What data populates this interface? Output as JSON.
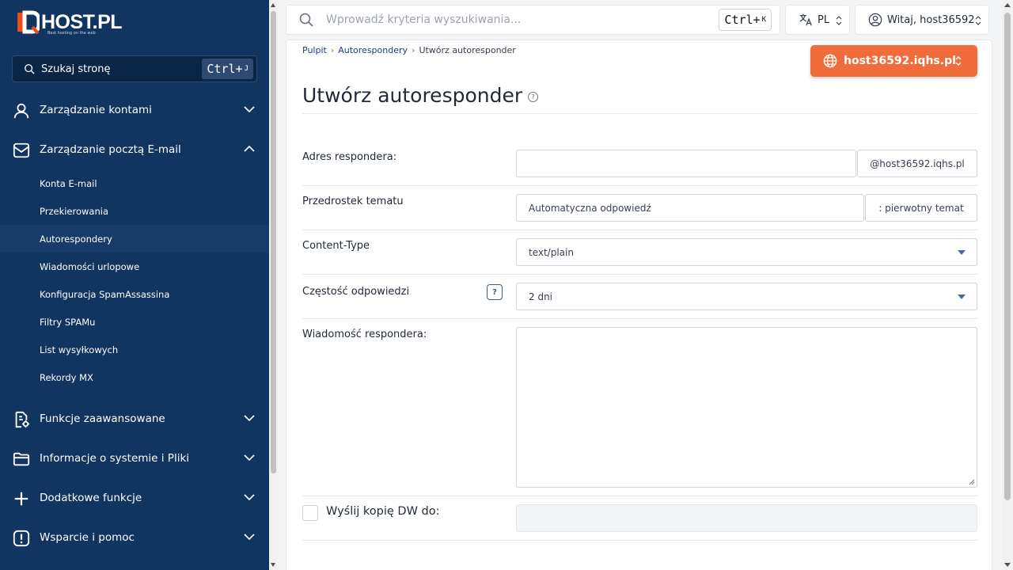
{
  "brand": {
    "name": "HOST.PL",
    "tagline": "Best hosting on the web"
  },
  "sidebar": {
    "search_label": "Szukaj stronę",
    "search_kbd": "Ctrl+",
    "search_kbd_key": "J",
    "groups": [
      {
        "label": "Zarządzanie kontami",
        "icon": "user-icon",
        "expanded": false
      },
      {
        "label": "Zarządzanie pocztą E-mail",
        "icon": "mail-icon",
        "expanded": true
      },
      {
        "label": "Funkcje zaawansowane",
        "icon": "document-gear-icon",
        "expanded": false
      },
      {
        "label": "Informacje o systemie i Pliki",
        "icon": "folder-icon",
        "expanded": false
      },
      {
        "label": "Dodatkowe funkcje",
        "icon": "plus-icon",
        "expanded": false
      },
      {
        "label": "Wsparcie i pomoc",
        "icon": "alert-icon",
        "expanded": false
      }
    ],
    "email_items": [
      {
        "label": "Konta E-mail"
      },
      {
        "label": "Przekierowania"
      },
      {
        "label": "Autorespondery",
        "active": true
      },
      {
        "label": "Wiadomości urlopowe"
      },
      {
        "label": "Konfiguracja SpamAssassina"
      },
      {
        "label": "Filtry SPAMu"
      },
      {
        "label": "List wysyłkowych"
      },
      {
        "label": "Rekordy MX"
      }
    ]
  },
  "topbar": {
    "search_placeholder": "Wprowadź kryteria wyszukiwania...",
    "search_kbd": "Ctrl+",
    "search_kbd_key": "K",
    "language": "PL",
    "user_greeting": "Witaj, host36592"
  },
  "breadcrumb": [
    "Pulpit",
    "Autorespondery",
    "Utwórz autoresponder"
  ],
  "domain_selector": "host36592.iqhs.pl",
  "page_title": "Utwórz autoresponder",
  "form": {
    "address_label": "Adres respondera:",
    "address_value": "",
    "address_suffix": "@host36592.iqhs.pl",
    "subject_label": "Przedrostek tematu",
    "subject_value": "Automatyczna odpowiedź",
    "subject_suffix": ": pierwotny temat",
    "content_type_label": "Content-Type",
    "content_type_value": "text/plain",
    "frequency_label": "Częstość odpowiedzi",
    "frequency_value": "2 dni",
    "message_label": "Wiadomość respondera:",
    "cc_label": "Wyślij kopię DW do:",
    "cc_checked": false
  },
  "colors": {
    "sidebar": "#113561",
    "accent": "#f26b3a",
    "link": "#1e3a8a"
  }
}
